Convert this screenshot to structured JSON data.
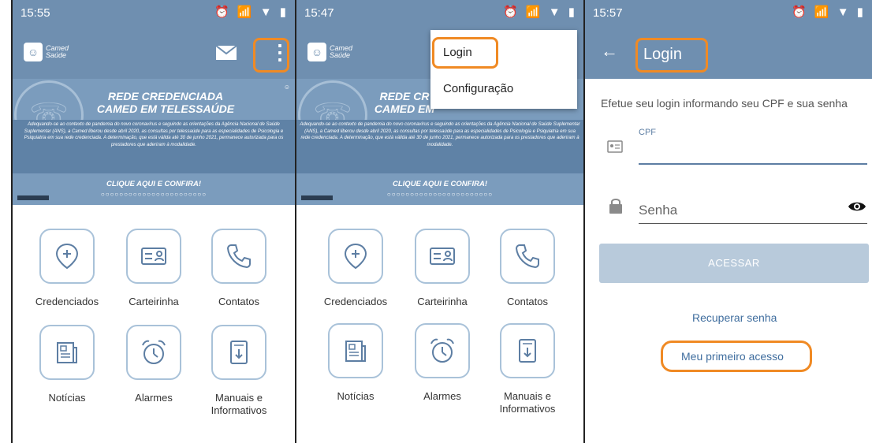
{
  "screens": [
    {
      "status": {
        "time": "15:55"
      },
      "logo": {
        "line1": "Camed",
        "line2": "Saúde"
      },
      "banner": {
        "title1": "REDE CREDENCIADA",
        "title2": "CAMED EM TELESSAÚDE",
        "body": "Adequando-se ao contexto de pandemia do novo coronavírus e seguindo as orientações da Agência Nacional de Saúde Suplementar (ANS), a Camed liberou desde abril 2020, as consultas por telessaúde para as especialidades de Psicologia e Psiquiatria em sua rede credenciada. A determinação, que está válida até 30 de junho 2021, permanece autorizada para os prestadores que aderiram à modalidade.",
        "cta": "CLIQUE AQUI E CONFIRA!",
        "dots": "○○○○○○○○○○○○○○○○○○○○○○○"
      },
      "tiles": [
        "Credenciados",
        "Carteirinha",
        "Contatos",
        "Notícias",
        "Alarmes",
        "Manuais e",
        "Informativos"
      ]
    },
    {
      "status": {
        "time": "15:47"
      },
      "logo": {
        "line1": "Camed",
        "line2": "Saúde"
      },
      "banner": {
        "title1": "REDE CR",
        "title2": "CAMED EM",
        "body": "Adequando-se ao contexto de pandemia do novo coronavírus e seguindo as orientações da Agência Nacional de Saúde Suplementar (ANS), a Camed liberou desde abril 2020, as consultas por telessaúde para as especialidades de Psicologia e Psiquiatria em sua rede credenciada. A determinação, que está válida até 30 de junho 2021, permanece autorizada para os prestadores que aderiram à modalidade.",
        "cta": "CLIQUE AQUI E CONFIRA!",
        "dots": "○○○○○○○○○○○○○○○○○○○○○○○"
      },
      "menu": [
        "Login",
        "Configuração"
      ],
      "tiles": [
        "Credenciados",
        "Carteirinha",
        "Contatos",
        "Notícias",
        "Alarmes",
        "Manuais e",
        "Informativos"
      ]
    },
    {
      "status": {
        "time": "15:57"
      },
      "title": "Login",
      "instruction": "Efetue seu login informando seu CPF e sua senha",
      "cpf_label": "CPF",
      "password_placeholder": "Senha",
      "submit": "ACESSAR",
      "recover": "Recuperar senha",
      "first_access": "Meu primeiro acesso"
    }
  ],
  "colors": {
    "primary": "#6f8fb0",
    "highlight": "#f08a24",
    "tile_border": "#a9c2d9",
    "button_disabled": "#b8cadb",
    "link": "#3f6d9e"
  }
}
